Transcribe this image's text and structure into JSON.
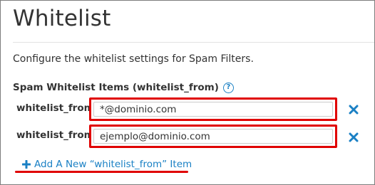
{
  "page": {
    "title": "Whitelist",
    "description": "Configure the whitelist settings for Spam Filters."
  },
  "section": {
    "label": "Spam Whitelist Items (whitelist_from)",
    "help_icon": "question-circle-icon"
  },
  "items": [
    {
      "label": "whitelist_from",
      "value": "*@dominio.com",
      "remove_icon": "close-x-icon"
    },
    {
      "label": "whitelist_from",
      "value": "ejemplo@dominio.com",
      "remove_icon": "close-x-icon"
    }
  ],
  "add_link": {
    "label": "Add A New “whitelist_from” Item",
    "icon": "plus-icon"
  },
  "colors": {
    "accent": "#1a80c4",
    "highlight": "#e00000",
    "text": "#333333"
  }
}
